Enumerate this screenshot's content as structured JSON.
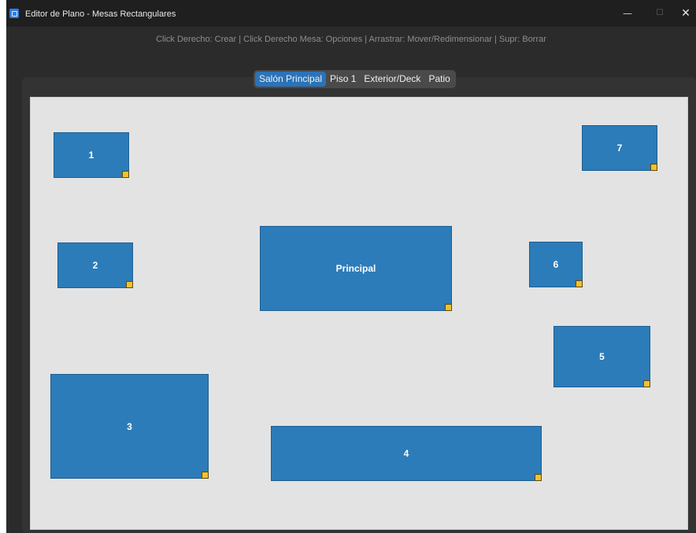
{
  "window": {
    "title": "Editor de Plano - Mesas Rectangulares",
    "minimize": "—",
    "maximize": "☐",
    "close": "✕"
  },
  "hint": "Click Derecho: Crear | Click Derecho Mesa: Opciones | Arrastrar: Mover/Redimensionar | Supr: Borrar",
  "tabs": [
    {
      "label": "Salón Principal",
      "active": true
    },
    {
      "label": "Piso 1",
      "active": false
    },
    {
      "label": "Exterior/Deck",
      "active": false
    },
    {
      "label": "Patio",
      "active": false
    }
  ],
  "colors": {
    "table_fill": "#2c7cb9",
    "resize_handle": "#f2c12e",
    "canvas_bg": "#e3e3e3",
    "active_tab": "#2b73b8"
  },
  "tables": [
    {
      "label": "1"
    },
    {
      "label": "7"
    },
    {
      "label": "2"
    },
    {
      "label": "Principal"
    },
    {
      "label": "6"
    },
    {
      "label": "5"
    },
    {
      "label": "3"
    },
    {
      "label": "4"
    }
  ]
}
